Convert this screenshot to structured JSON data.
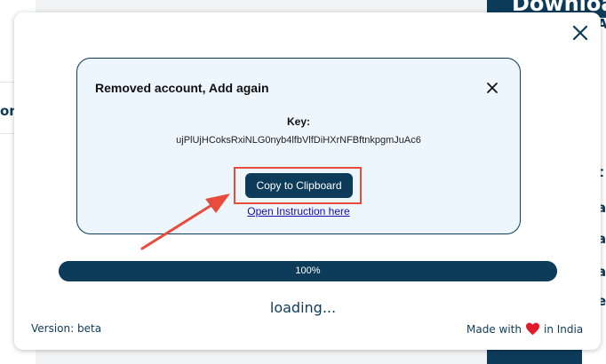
{
  "background": {
    "left_text": "on",
    "right_title": "Downloa",
    "right_letters": [
      "A",
      "i",
      "l",
      "i",
      "t",
      "a",
      "a",
      "a",
      "e"
    ]
  },
  "dialog": {
    "title": "Removed account, Add again",
    "key_label": "Key:",
    "key_value": "ujPlUjHCoksRxiNLG0nyb4lfbVlfDiHXrNFBftnkpgmJuAc6",
    "copy_button": "Copy to Clipboard",
    "instruction_link": "Open Instruction here"
  },
  "progress": {
    "value": 100,
    "label": "100%"
  },
  "status": {
    "loading": "loading..."
  },
  "footer": {
    "version": "Version: beta",
    "made_with": "Made with",
    "in_country": "in India"
  },
  "icons": {
    "modal_close": "close-icon",
    "dialog_close": "close-icon",
    "heart": "heart-icon",
    "arrow": "arrow-annotation"
  },
  "colors": {
    "primary": "#0d3b5a",
    "highlight": "#e74c3c",
    "heart": "#e21b2b",
    "link": "#1a0dab",
    "dialog_bg": "#eef6fd"
  }
}
